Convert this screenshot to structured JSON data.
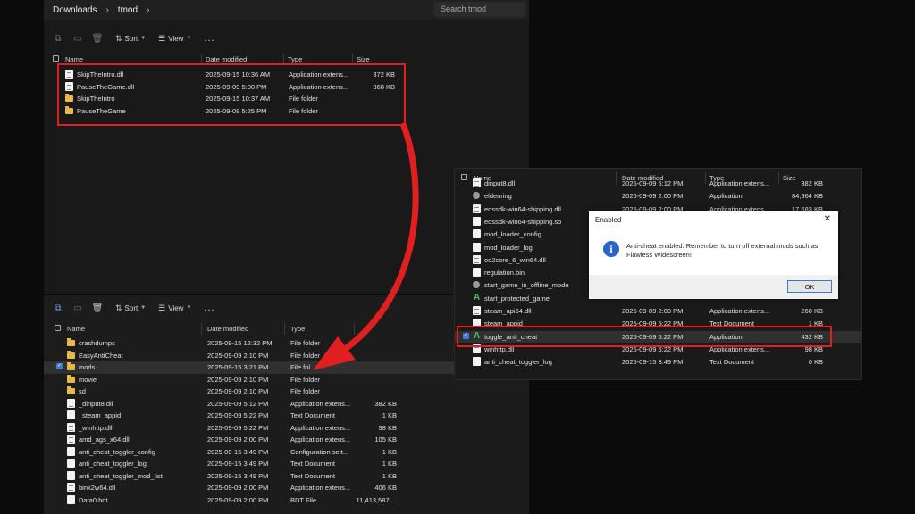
{
  "top_window": {
    "breadcrumb": [
      "Downloads",
      "tmod"
    ],
    "search_placeholder": "Search tmod",
    "toolbar": {
      "sort": "Sort",
      "view": "View",
      "more": "..."
    },
    "columns": [
      "Name",
      "Date modified",
      "Type",
      "Size"
    ],
    "rows": [
      {
        "name": "SkipTheIntro.dll",
        "date": "2025-09-15 10:36 AM",
        "type": "Application extens...",
        "size": "372 KB",
        "icon": "dll-file-icon"
      },
      {
        "name": "PauseTheGame.dll",
        "date": "2025-09-09 5:00 PM",
        "type": "Application extens...",
        "size": "368 KB",
        "icon": "dll-file-icon"
      },
      {
        "name": "SkipTheIntro",
        "date": "2025-09-15 10:37 AM",
        "type": "File folder",
        "size": "",
        "icon": "folder-icon"
      },
      {
        "name": "PauseTheGame",
        "date": "2025-09-09 5:25 PM",
        "type": "File folder",
        "size": "",
        "icon": "folder-icon"
      }
    ]
  },
  "bottom_window": {
    "toolbar": {
      "sort": "Sort",
      "view": "View",
      "more": "..."
    },
    "columns": [
      "Name",
      "Date modified",
      "Type",
      "Size"
    ],
    "rows": [
      {
        "name": "crashdumps",
        "date": "2025-09-15 12:32 PM",
        "type": "File folder",
        "size": "",
        "icon": "folder-icon"
      },
      {
        "name": "EasyAntiCheat",
        "date": "2025-09-09 2:10 PM",
        "type": "File folder",
        "size": "",
        "icon": "folder-icon"
      },
      {
        "name": "mods",
        "date": "2025-09-15 3:21 PM",
        "type": "File fol",
        "size": "",
        "icon": "folder-icon",
        "selected": true
      },
      {
        "name": "movie",
        "date": "2025-09-09 2:10 PM",
        "type": "File folder",
        "size": "",
        "icon": "folder-icon"
      },
      {
        "name": "sd",
        "date": "2025-09-09 2:10 PM",
        "type": "File folder",
        "size": "",
        "icon": "folder-icon"
      },
      {
        "name": "_dinput8.dll",
        "date": "2025-09-09 5:12 PM",
        "type": "Application extens...",
        "size": "382 KB",
        "icon": "dll-file-icon"
      },
      {
        "name": "_steam_appid",
        "date": "2025-09-09 5:22 PM",
        "type": "Text Document",
        "size": "1 KB",
        "icon": "text-file-icon"
      },
      {
        "name": "_winhttp.dll",
        "date": "2025-09-09 5:22 PM",
        "type": "Application extens...",
        "size": "98 KB",
        "icon": "dll-file-icon"
      },
      {
        "name": "amd_ags_x64.dll",
        "date": "2025-09-09 2:00 PM",
        "type": "Application extens...",
        "size": "105 KB",
        "icon": "dll-file-icon"
      },
      {
        "name": "anti_cheat_toggler_config",
        "date": "2025-09-15 3:49 PM",
        "type": "Configuration sett...",
        "size": "1 KB",
        "icon": "config-file-icon"
      },
      {
        "name": "anti_cheat_toggler_log",
        "date": "2025-09-15 3:49 PM",
        "type": "Text Document",
        "size": "1 KB",
        "icon": "text-file-icon"
      },
      {
        "name": "anti_cheat_toggler_mod_list",
        "date": "2025-09-15 3:49 PM",
        "type": "Text Document",
        "size": "1 KB",
        "icon": "text-file-icon"
      },
      {
        "name": "bink2w64.dll",
        "date": "2025-09-09 2:00 PM",
        "type": "Application extens...",
        "size": "406 KB",
        "icon": "dll-file-icon"
      },
      {
        "name": "Data0.bdt",
        "date": "2025-09-09 2:00 PM",
        "type": "BDT File",
        "size": "11,413,587 ...",
        "icon": "file-icon"
      }
    ]
  },
  "right_window": {
    "columns": [
      "Name",
      "Date modified",
      "Type",
      "Size"
    ],
    "rows": [
      {
        "name": "dinput8.dll",
        "date": "2025-09-09 5:12 PM",
        "type": "Application extens...",
        "size": "382 KB",
        "icon": "dll-file-icon"
      },
      {
        "name": "eldenring",
        "date": "2025-09-09 2:00 PM",
        "type": "Application",
        "size": "84,964 KB",
        "icon": "gear-app-icon"
      },
      {
        "name": "eossdk-win64-shipping.dll",
        "date": "2025-09-09 2:00 PM",
        "type": "Application extens...",
        "size": "17,683 KB",
        "icon": "dll-file-icon"
      },
      {
        "name": "eossdk-win64-shipping.so",
        "date": "",
        "type": "",
        "size": "",
        "icon": "file-icon"
      },
      {
        "name": "mod_loader_config",
        "date": "",
        "type": "",
        "size": "",
        "icon": "config-file-icon"
      },
      {
        "name": "mod_loader_log",
        "date": "",
        "type": "",
        "size": "",
        "icon": "text-file-icon"
      },
      {
        "name": "oo2core_6_win64.dll",
        "date": "",
        "type": "",
        "size": "",
        "icon": "dll-file-icon"
      },
      {
        "name": "regulation.bin",
        "date": "",
        "type": "",
        "size": "",
        "icon": "file-icon"
      },
      {
        "name": "start_game_in_offline_mode",
        "date": "",
        "type": "",
        "size": "",
        "icon": "gear-app-icon"
      },
      {
        "name": "start_protected_game",
        "date": "",
        "type": "",
        "size": "",
        "icon": "green-a-app-icon"
      },
      {
        "name": "steam_api64.dll",
        "date": "2025-09-09 2:00 PM",
        "type": "Application extens...",
        "size": "260 KB",
        "icon": "dll-file-icon"
      },
      {
        "name": "steam_appid",
        "date": "2025-09-09 5:22 PM",
        "type": "Text Document",
        "size": "1 KB",
        "icon": "text-file-icon"
      },
      {
        "name": "toggle_anti_cheat",
        "date": "2025-09-09 5:22 PM",
        "type": "Application",
        "size": "432 KB",
        "icon": "green-a-app-icon",
        "selected": true
      },
      {
        "name": "winhttp.dll",
        "date": "2025-09-09 5:22 PM",
        "type": "Application extens...",
        "size": "98 KB",
        "icon": "dll-file-icon"
      },
      {
        "name": "anti_cheat_toggler_log",
        "date": "2025-09-15 3:49 PM",
        "type": "Text Document",
        "size": "0 KB",
        "icon": "text-file-icon"
      }
    ]
  },
  "dialog": {
    "title": "Enabled",
    "message": "Anti-cheat enabled. Remember to turn off external mods such as Flawless Widescreen!",
    "ok": "OK",
    "close": "✕"
  },
  "colors": {
    "highlight": "#e02020",
    "folder": "#e8b84a",
    "accent": "#3d7bd6"
  }
}
